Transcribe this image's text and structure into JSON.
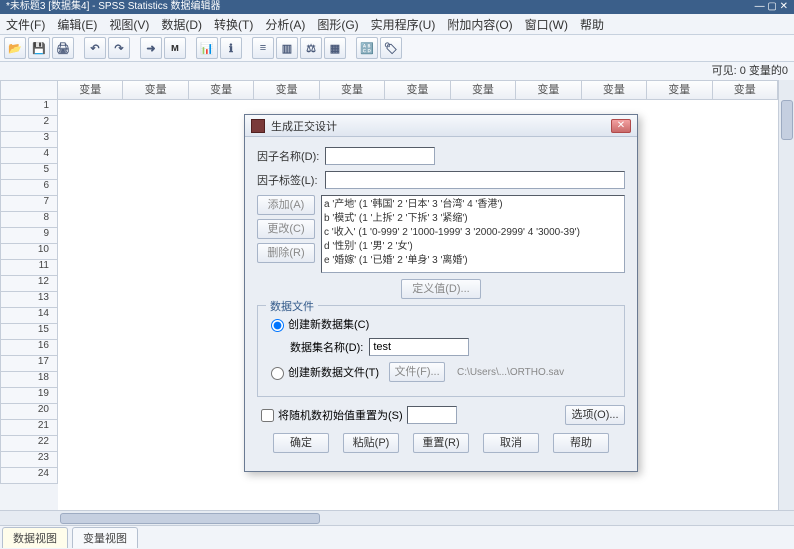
{
  "window_title": "*未标题3 [数据集4] - SPSS Statistics 数据编辑器",
  "menu": {
    "file": "文件(F)",
    "edit": "编辑(E)",
    "view": "视图(V)",
    "data": "数据(D)",
    "transform": "转换(T)",
    "analyze": "分析(A)",
    "graphs": "图形(G)",
    "utilities": "实用程序(U)",
    "addons": "附加内容(O)",
    "window": "窗口(W)",
    "help": "帮助"
  },
  "status_right": "可见: 0 变量的0",
  "column_header": "变量",
  "tabs": {
    "data_view": "数据视图",
    "variable_view": "变量视图"
  },
  "dialog": {
    "title": "生成正交设计",
    "factor_name_label": "因子名称(D):",
    "factor_label_label": "因子标签(L):",
    "factor_name_value": "",
    "factor_label_value": "",
    "add_btn": "添加(A)",
    "change_btn": "更改(C)",
    "remove_btn": "删除(R)",
    "list_items": [
      "a '产地' (1 '韩国' 2 '日本' 3 '台湾' 4 '香港')",
      "b '模式' (1 '上拆' 2 '下拆' 3 '紧缩')",
      "c '收入' (1 '0-999' 2 '1000-1999' 3 '2000-2999' 4 '3000-39')",
      "d '性别' (1 '男' 2 '女')",
      "e '婚嫁' (1 '已婚' 2 '单身' 3 '离婚')"
    ],
    "define_values_btn": "定义值(D)...",
    "group_legend": "数据文件",
    "radio_create_dataset": "创建新数据集(C)",
    "dataset_name_label": "数据集名称(D):",
    "dataset_name_value": "test",
    "radio_create_file": "创建新数据文件(T)",
    "file_btn": "文件(F)...",
    "file_path": "C:\\Users\\...\\ORTHO.sav",
    "reset_seed_checkbox": "将随机数初始值重置为(S)",
    "seed_value": "",
    "options_btn": "选项(O)...",
    "ok": "确定",
    "paste": "粘贴(P)",
    "reset": "重置(R)",
    "cancel": "取消",
    "help": "帮助"
  }
}
